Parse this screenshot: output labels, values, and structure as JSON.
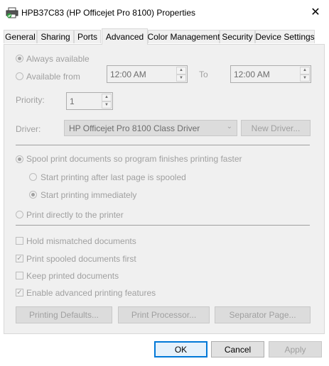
{
  "window": {
    "title": "HPB37C83 (HP Officejet Pro 8100) Properties",
    "close_glyph": "✕",
    "icon": "printer-icon"
  },
  "tabs": [
    {
      "label": "General"
    },
    {
      "label": "Sharing"
    },
    {
      "label": "Ports"
    },
    {
      "label": "Advanced"
    },
    {
      "label": "Color Management"
    },
    {
      "label": "Security"
    },
    {
      "label": "Device Settings"
    }
  ],
  "availability": {
    "always_label": "Always available",
    "from_label": "Available from",
    "from_time": "12:00 AM",
    "to_label": "To",
    "to_time": "12:00 AM"
  },
  "priority": {
    "label": "Priority:",
    "value": "1"
  },
  "driver": {
    "label": "Driver:",
    "value": "HP Officejet Pro 8100 Class Driver",
    "new_driver_button": "New Driver..."
  },
  "spooling": {
    "spool_label": "Spool print documents so program finishes printing faster",
    "after_last_page_label": "Start printing after last page is spooled",
    "immediately_label": "Start printing immediately",
    "direct_label": "Print directly to the printer"
  },
  "options": {
    "hold_mismatched": "Hold mismatched documents",
    "spooled_first": "Print spooled documents first",
    "keep_printed": "Keep printed documents",
    "advanced_features": "Enable advanced printing features"
  },
  "bottom_buttons": {
    "printing_defaults": "Printing Defaults...",
    "print_processor": "Print Processor...",
    "separator_page": "Separator Page..."
  },
  "footer": {
    "ok": "OK",
    "cancel": "Cancel",
    "apply": "Apply"
  },
  "colors": {
    "accent": "#0078d7",
    "disabled_text": "#a0a0a0",
    "panel_bg": "#f0f0f0"
  }
}
